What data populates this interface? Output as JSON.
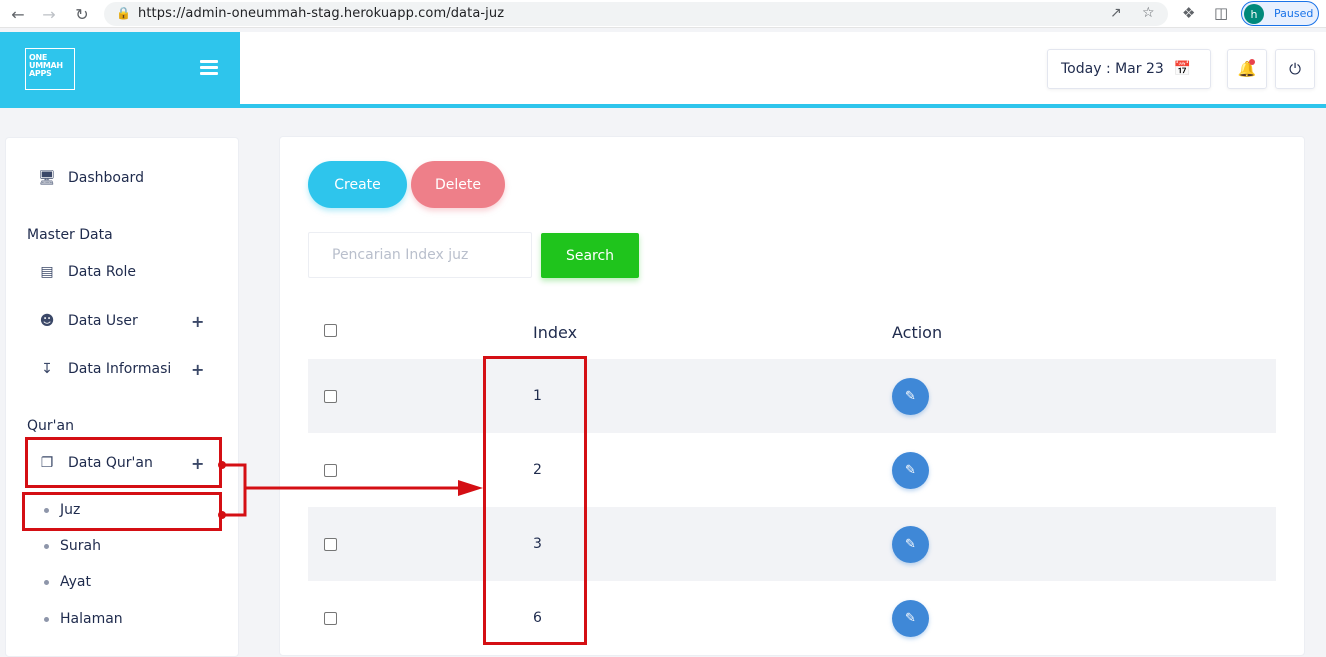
{
  "browser": {
    "url": "https://admin-oneummah-stag.herokuapp.com/data-juz",
    "profile_initial": "h",
    "profile_status": "Paused"
  },
  "brand": {
    "logo_lines": [
      "ONE",
      "UMMAH",
      "APPS"
    ]
  },
  "topbar": {
    "today_label": "Today : Mar 23"
  },
  "sidebar": {
    "dashboard": "Dashboard",
    "section_master": "Master Data",
    "data_role": "Data Role",
    "data_user": "Data User",
    "data_informasi": "Data Informasi",
    "section_quran": "Qur'an",
    "data_quran": "Data Qur'an",
    "sub_items": [
      "Juz",
      "Surah",
      "Ayat",
      "Halaman"
    ]
  },
  "main": {
    "create_label": "Create",
    "delete_label": "Delete",
    "search_placeholder": "Pencarian Index juz",
    "search_label": "Search",
    "col_index": "Index",
    "col_action": "Action",
    "rows": [
      "1",
      "2",
      "3",
      "6"
    ]
  },
  "colors": {
    "brand": "#2ec5ec",
    "create": "#2ec5ec",
    "delete": "#ee7f89",
    "search": "#1fc41c",
    "edit": "#3f88d7",
    "annotation": "#d40f14"
  }
}
